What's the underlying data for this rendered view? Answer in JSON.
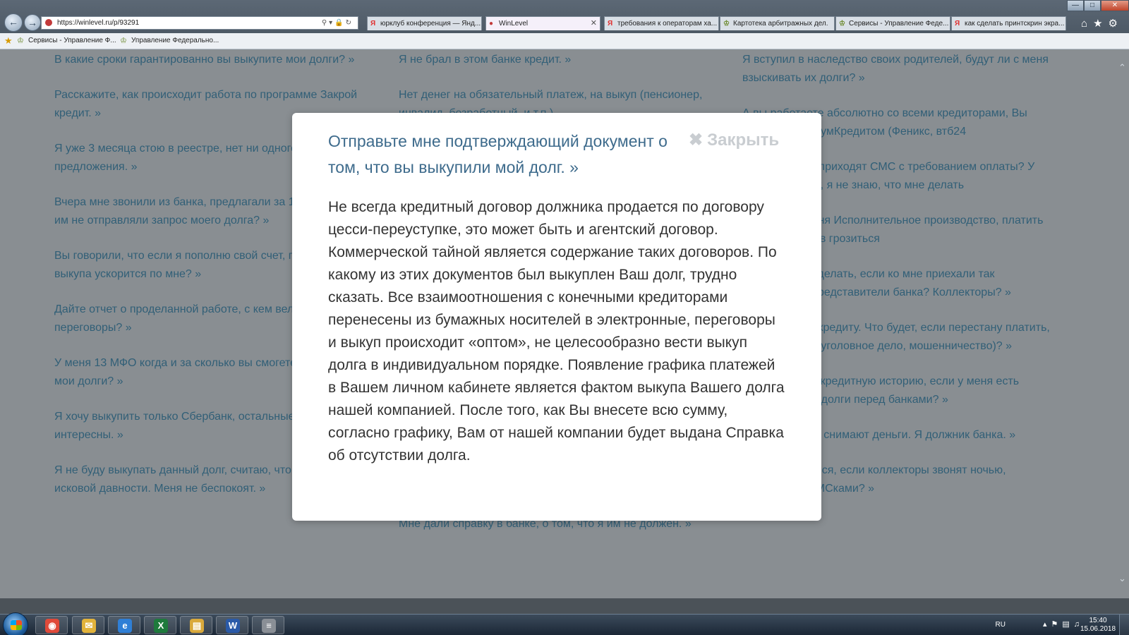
{
  "browser": {
    "url": "https://winlevel.ru/p/93291",
    "tabs": [
      {
        "label": "юрклуб конференция — Янд...",
        "icon": "yandex-icon"
      },
      {
        "label": "WinLevel",
        "icon": "winlevel-icon",
        "active": true
      },
      {
        "label": "требования к операторам ха...",
        "icon": "yandex-icon"
      },
      {
        "label": "Картотека арбитражных дел.",
        "icon": "arbitr-icon"
      },
      {
        "label": "Сервисы - Управление Феде...",
        "icon": "emblem-icon"
      },
      {
        "label": "как сделать принтскрин экра...",
        "icon": "yandex-icon"
      }
    ],
    "favorites": [
      {
        "label": "Сервисы - Управление Ф..."
      },
      {
        "label": "Управление Федерально..."
      }
    ]
  },
  "page": {
    "col1": [
      "В какие сроки гарантированно вы выкупите мои долги? »",
      "Расскажите, как происходит работа по программе Закрой кредит. »",
      "Я уже 3 месяца стою в реестре, нет ни одного предложения. »",
      "Вчера мне звонили из банка, предлагали за 15%, вы, что им не отправляли запрос моего долга? »",
      "Вы говорили, что если я пополню свой счет, процесс выкупа ускорится по мне? »",
      "Дайте отчет о проделанной работе, с кем вели переговоры? »",
      "У меня 13 МФО когда и за сколько вы смогете выкупить мои долги? »",
      "Я хочу выкупить только Сбербанк, остальные мне не интересны. »",
      "Я не буду выкупать данный долг, считаю, что сроки исковой давности. Меня не беспокоят. »"
    ],
    "col2": [
      "Я не брал в этом банке кредит. »",
      "Нет денег на обязательный платеж, на выкуп (пенсионер, инвалид, безработный, и т.п.)",
      "",
      "",
      "",
      "",
      "",
      "",
      "",
      "Мне дали справку в банке, о том, что я им не должен. »"
    ],
    "col3": [
      "Я вступил в наследство своих родителей, будут ли с меня взыскивать их долги? »",
      "А вы работаете абсолютно со всеми кредиторами, Вы напрямую с ХоумКредитом (Феникс, втб24",
      "Что, если мне приходят СМС с требованием оплаты? У меня нет денег, я не знаю, что мне делать",
      "Что, если у меня Исполнительное производство, платить не чем, пристав грозиться",
      "Что мне и что делать, если ко мне приехали так называемые представители банка? Коллекторы? »",
      "Я не плачу по кредиту. Что будет, если перестану платить, меня посадят (уголовное дело, мошенничество)? »",
      "Как исправить кредитную историю, если у меня есть просроченные долги перед банками? »",
      "С меня с счета снимают деньги. Я должник банка. »",
      "Куда обращаться, если коллекторы звонят ночью, заваливают СМСками? »"
    ]
  },
  "modal": {
    "title": "Отправьте мне подтверждающий документ о том, что вы выкупили мой долг. »",
    "close_label": "Закрыть",
    "body": "Не всегда кредитный договор должника продается по договору цесси-переуступке, это может быть и агентский договор. Коммерческой тайной является содержание таких договоров. По какому из этих документов был выкуплен Ваш долг, трудно сказать. Все взаимоотношения с конечными кредиторами перенесены из бумажных носителей в электронные, переговоры и выкуп происходит «оптом», не целесообразно вести выкуп долга в индивидуальном порядке. Появление графика платежей в Вашем личном кабинете является фактом выкупа Вашего долга нашей компанией. После того, как Вы внесете всю сумму, согласно графику, Вам от нашей компании будет выдана Справка об отсутствии долга."
  },
  "taskbar": {
    "apps": [
      {
        "icon": "chrome-icon",
        "letter": "◉",
        "color": "#e04a3a"
      },
      {
        "icon": "mail-icon",
        "letter": "✉",
        "color": "#e2b33b"
      },
      {
        "icon": "ie-icon",
        "letter": "e",
        "color": "#2f7fd6"
      },
      {
        "icon": "excel-icon",
        "letter": "X",
        "color": "#1e7a3c"
      },
      {
        "icon": "explorer-icon",
        "letter": "▤",
        "color": "#d9a93c"
      },
      {
        "icon": "word-icon",
        "letter": "W",
        "color": "#2a5aa8"
      },
      {
        "icon": "document-icon",
        "letter": "≡",
        "color": "#8a8f96"
      }
    ],
    "lang": "RU",
    "time": "15:40",
    "date": "15.06.2018"
  }
}
